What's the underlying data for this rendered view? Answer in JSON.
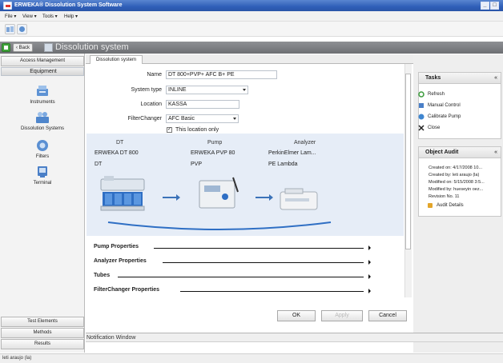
{
  "window": {
    "title": "ERWEKA® Dissolution System Software",
    "controls": [
      "_",
      "□"
    ]
  },
  "menubar": [
    "File",
    "View",
    "Tools",
    "Help"
  ],
  "nav": {
    "back_label": "‹ Back",
    "title": "Dissolution system"
  },
  "sidebar": {
    "access_management": "Access Management",
    "equipment": "Equipment",
    "items": [
      {
        "label": "Instruments",
        "icon": "instruments-icon"
      },
      {
        "label": "Dissolution Systems",
        "icon": "dissolution-systems-icon"
      },
      {
        "label": "Filters",
        "icon": "filters-icon"
      },
      {
        "label": "Terminal",
        "icon": "terminal-icon"
      }
    ],
    "test_elements": "Test Elements",
    "methods": "Methods",
    "results": "Results"
  },
  "tab": {
    "label": "Dissolution system"
  },
  "form": {
    "name_label": "Name",
    "name_value": "DT 800+PVP+ AFC B+ PE",
    "system_type_label": "System type",
    "system_type_value": "INLINE",
    "location_label": "Location",
    "location_value": "KASSA",
    "filterchanger_label": "FilterChanger",
    "filterchanger_value": "AFC Basic",
    "this_location_only_label": "This location only",
    "this_location_only_checked": true
  },
  "diagram": {
    "columns": [
      {
        "heading": "DT",
        "line1": "ERWEKA DT 800",
        "line2": "DT"
      },
      {
        "heading": "Pump",
        "line1": "ERWEKA PVP 80",
        "line2": "PVP"
      },
      {
        "heading": "Analyzer",
        "line1": "PerkinElmer Lam...",
        "line2": "PE Lambda"
      }
    ]
  },
  "sections": [
    "Pump Properties",
    "Analyzer Properties",
    "Tubes",
    "FilterChanger Properties"
  ],
  "buttons": {
    "ok": "OK",
    "apply": "Apply",
    "cancel": "Cancel"
  },
  "tasks": {
    "title": "Tasks",
    "close_glyph": "«",
    "items": [
      {
        "label": "Refresh",
        "icon": "refresh-icon",
        "color": "#3a9a3a"
      },
      {
        "label": "Manual Control",
        "icon": "manual-control-icon",
        "color": "#4a7fc7"
      },
      {
        "label": "Calibrate Pump",
        "icon": "calibrate-pump-icon",
        "color": "#3f86d0"
      },
      {
        "label": "Close",
        "icon": "close-icon",
        "color": "#222222"
      }
    ]
  },
  "object_audit": {
    "title": "Object Audit",
    "close_glyph": "«",
    "lines": [
      "Created on: 4/17/2008 10...",
      "Created by: leti araujo (la)",
      "Modified on: 5/15/2008 3:5...",
      "Modified by: hueseyin oez...",
      "Revision No. 11"
    ],
    "audit_details": "Audit Details"
  },
  "notification_window": "Notification Window",
  "status": "leti araujo (la)",
  "colors": {
    "titlebar": "#2f5fb8",
    "navbar": "#7b7d81",
    "accent_blue": "#3b72b8",
    "diagram_bg": "#e6edf7"
  }
}
